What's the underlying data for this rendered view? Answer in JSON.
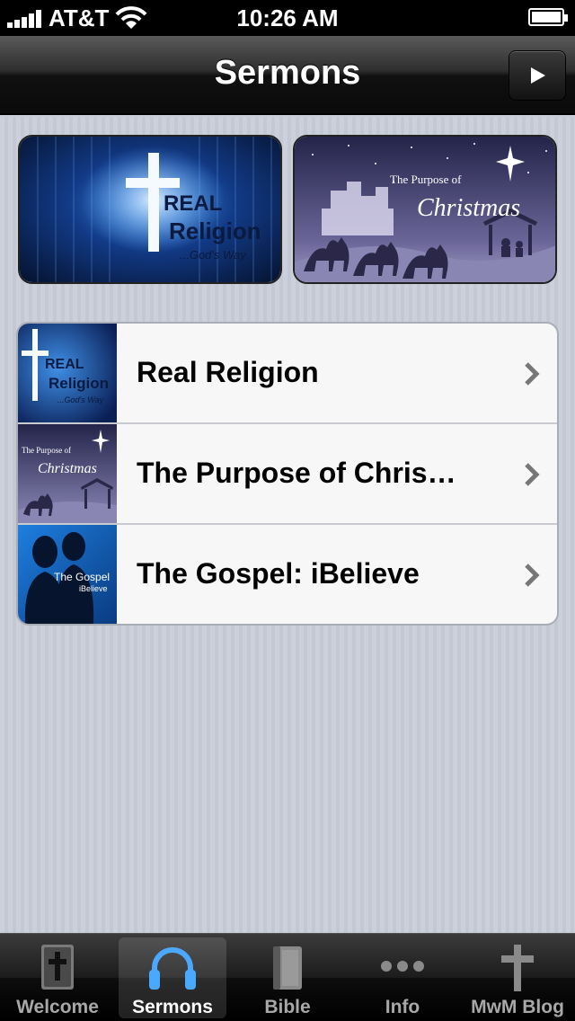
{
  "status_bar": {
    "carrier": "AT&T",
    "time": "10:26 AM"
  },
  "nav": {
    "title": "Sermons",
    "play_icon": "play-icon"
  },
  "featured": [
    {
      "title_line1": "REAL",
      "title_line2": "Religion",
      "subtitle": "...God's Way"
    },
    {
      "pre_title": "The Purpose of",
      "title": "Christmas"
    }
  ],
  "sermons": [
    {
      "label": "Real Religion",
      "thumb": {
        "line1": "REAL",
        "line2": "Religion",
        "line3": "...God's Way"
      }
    },
    {
      "label": "The Purpose of Chris…",
      "thumb": {
        "line1": "The Purpose of",
        "line2": "Christmas"
      }
    },
    {
      "label": "The Gospel: iBelieve",
      "thumb": {
        "line1": "The Gospel",
        "line2": "iBelieve"
      }
    }
  ],
  "tabs": [
    {
      "label": "Welcome",
      "icon": "bible-cross-icon",
      "active": false
    },
    {
      "label": "Sermons",
      "icon": "headphones-icon",
      "active": true
    },
    {
      "label": "Bible",
      "icon": "book-icon",
      "active": false
    },
    {
      "label": "Info",
      "icon": "more-dots-icon",
      "active": false
    },
    {
      "label": "MwM Blog",
      "icon": "cross-icon",
      "active": false
    }
  ],
  "colors": {
    "active_tab_icon": "#4aa8ff",
    "banner_blue": "#123a86",
    "banner_purple": "#5d5785"
  }
}
